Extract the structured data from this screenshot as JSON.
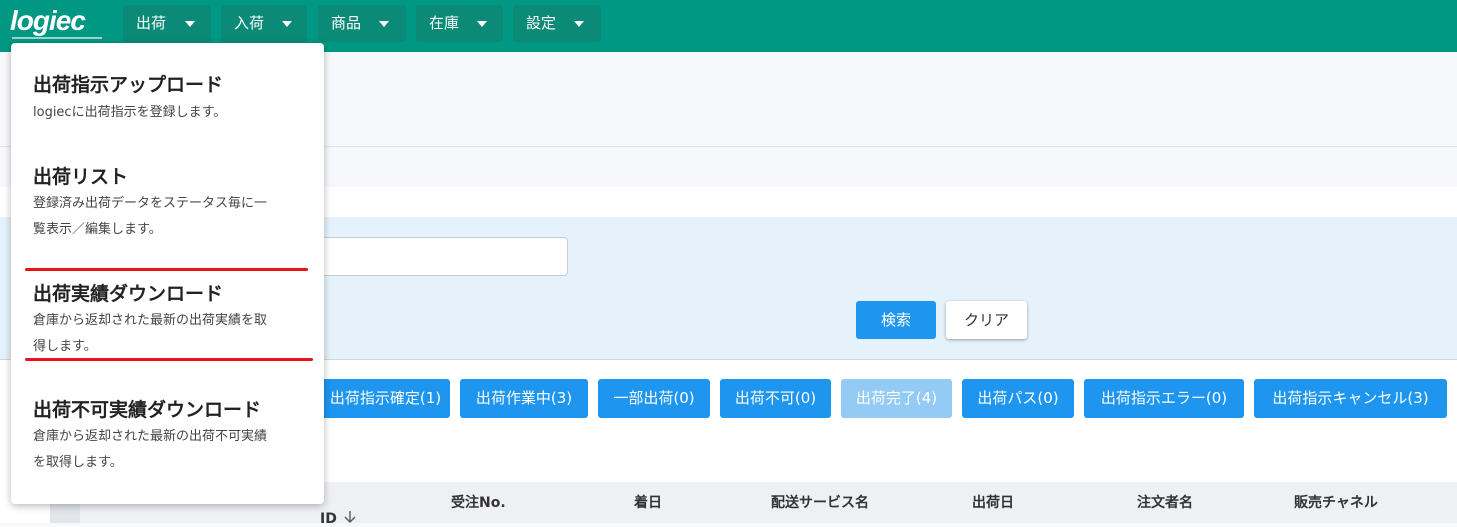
{
  "app": {
    "logo_text": "logiec"
  },
  "nav": {
    "items": [
      {
        "label": "出荷"
      },
      {
        "label": "入荷"
      },
      {
        "label": "商品"
      },
      {
        "label": "在庫"
      },
      {
        "label": "設定"
      }
    ]
  },
  "search": {
    "search_button": "検索",
    "clear_button": "クリア"
  },
  "status_tabs": [
    {
      "label": "出荷指示確定(1)"
    },
    {
      "label": "出荷作業中(3)"
    },
    {
      "label": "一部出荷(0)"
    },
    {
      "label": "出荷不可(0)"
    },
    {
      "label": "出荷完了(4)"
    },
    {
      "label": "出荷パス(0)"
    },
    {
      "label": "出荷指示エラー(0)"
    },
    {
      "label": "出荷指示キャンセル(3)"
    }
  ],
  "table": {
    "columns": [
      "ID",
      "受注No.",
      "着日",
      "配送サービス名",
      "出荷日",
      "注文者名",
      "販売チャネル"
    ]
  },
  "dropdown": {
    "items": [
      {
        "title": "出荷指示アップロード",
        "desc_lines": [
          "logiecに出荷指示を登録します。"
        ]
      },
      {
        "title": "出荷リスト",
        "desc_lines": [
          "登録済み出荷データをステータス毎に一",
          "覧表示／編集します。"
        ]
      },
      {
        "title": "出荷実績ダウンロード",
        "desc_lines": [
          "倉庫から返却された最新の出荷実績を取",
          "得します。"
        ]
      },
      {
        "title": "出荷不可実績ダウンロード",
        "desc_lines": [
          "倉庫から返却された最新の出荷不可実績",
          "を取得します。"
        ]
      }
    ]
  },
  "colors": {
    "header": "#009883",
    "primary_button": "#1e96f0",
    "highlight_underline": "#e8141a"
  }
}
